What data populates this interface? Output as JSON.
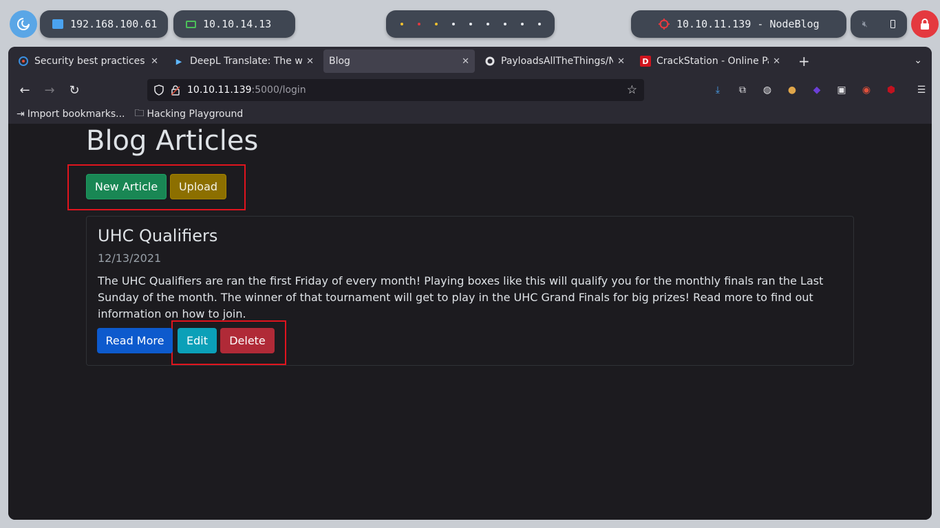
{
  "desktop": {
    "local_ip": "192.168.100.61",
    "vpn_ip": "10.10.14.13",
    "target": "10.10.11.139 - NodeBlog",
    "colors": {
      "local_icon": "#4aa3f0",
      "vpn_icon": "#4cc15a",
      "target_icon": "#e4393f",
      "dots": [
        "#f2c12e",
        "#e4393f",
        "#f2c12e",
        "#e6e9ee",
        "#e6e9ee",
        "#e6e9ee",
        "#e6e9ee",
        "#e6e9ee",
        "#e6e9ee"
      ]
    }
  },
  "browser": {
    "tabs": [
      {
        "label": "Security best practices | ",
        "icon": "swirl-icon",
        "active": false
      },
      {
        "label": "DeepL Translate: The wo",
        "icon": "deepl-icon",
        "active": false
      },
      {
        "label": "Blog",
        "icon": "",
        "active": true
      },
      {
        "label": "PayloadsAllTheThings/No",
        "icon": "github-icon",
        "active": false
      },
      {
        "label": "CrackStation - Online Pas",
        "icon": "crackstation-icon",
        "active": false
      }
    ],
    "url": {
      "host": "10.10.11.139",
      "rest": ":5000/login"
    },
    "bookmarks": [
      {
        "label": "Import bookmarks...",
        "icon": "import-icon"
      },
      {
        "label": "Hacking Playground",
        "icon": "folder-icon"
      }
    ]
  },
  "page": {
    "heading": "Blog Articles",
    "buttons": {
      "new_article": "New Article",
      "upload": "Upload"
    },
    "articles": [
      {
        "title": "UHC Qualifiers",
        "date": "12/13/2021",
        "body": "The UHC Qualifiers are ran the first Friday of every month! Playing boxes like this will qualify you for the monthly finals ran the Last Sunday of the month. The winner of that tournament will get to play in the UHC Grand Finals for big prizes! Read more to find out information on how to join.",
        "read_more": "Read More",
        "edit": "Edit",
        "delete": "Delete"
      }
    ]
  }
}
